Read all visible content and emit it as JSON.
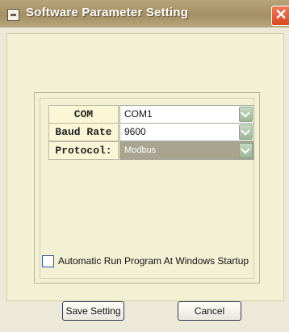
{
  "window": {
    "title": "Software Parameter Setting",
    "close_glyph": "✕"
  },
  "fields": [
    {
      "label": "COM",
      "value": "COM1",
      "enabled": true
    },
    {
      "label": "Baud Rate",
      "value": "9600",
      "enabled": true
    },
    {
      "label": "Protocol:",
      "value": "Modbus",
      "enabled": false
    }
  ],
  "startup": {
    "label": "Automatic Run Program At Windows Startup",
    "checked": false
  },
  "buttons": {
    "save": "Save Setting",
    "cancel": "Cancel"
  }
}
